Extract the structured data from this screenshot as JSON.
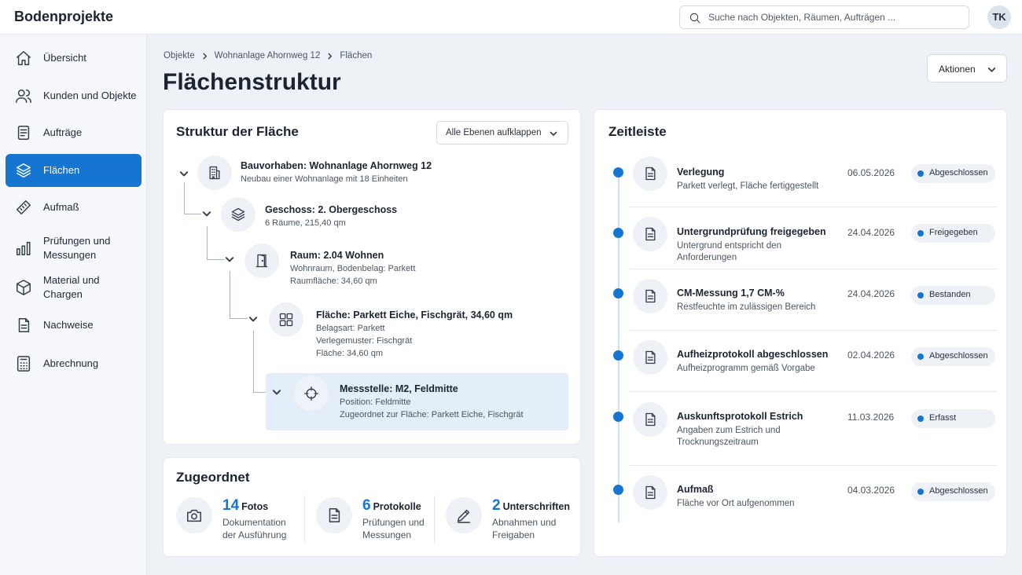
{
  "header": {
    "app_title": "Bodenprojekte",
    "search_placeholder": "Suche nach Objekten, Räumen, Aufträgen ...",
    "user_initials": "TK"
  },
  "sidebar": {
    "items": [
      {
        "label": "Übersicht",
        "icon": "home-icon",
        "active": false
      },
      {
        "label": "Kunden und Objekte",
        "icon": "users-icon",
        "active": false
      },
      {
        "label": "Aufträge",
        "icon": "document-icon",
        "active": false
      },
      {
        "label": "Flächen",
        "icon": "layers-icon",
        "active": true
      },
      {
        "label": "Aufmaß",
        "icon": "ruler-icon",
        "active": false
      },
      {
        "label": "Prüfungen und Messungen",
        "icon": "bar-chart-icon",
        "active": false
      },
      {
        "label": "Material und Chargen",
        "icon": "box-icon",
        "active": false
      },
      {
        "label": "Nachweise",
        "icon": "file-check-icon",
        "active": false
      },
      {
        "label": "Abrechnung",
        "icon": "calculator-icon",
        "active": false
      }
    ]
  },
  "breadcrumb": [
    "Objekte",
    "Wohnanlage Ahornweg 12",
    "Flächen"
  ],
  "page_title": "Flächenstruktur",
  "actions_label": "Aktionen",
  "structure": {
    "title": "Struktur der Fläche",
    "expand_label": "Alle Ebenen aufklappen",
    "nodes": [
      {
        "title": "Bauvorhaben: Wohnanlage Ahornweg 12",
        "lines": [
          "Neubau einer Wohnanlage mit 18 Einheiten"
        ],
        "icon": "building-icon"
      },
      {
        "title": "Geschoss: 2. Obergeschoss",
        "lines": [
          "6 Räume, 215,40 qm"
        ],
        "icon": "layers-icon"
      },
      {
        "title": "Raum: 2.04 Wohnen",
        "lines": [
          "Wohnraum, Bodenbelag: Parkett",
          "Raumfläche: 34,60 qm"
        ],
        "icon": "door-icon"
      },
      {
        "title": "Fläche: Parkett Eiche, Fischgrät, 34,60 qm",
        "lines": [
          "Belagsart: Parkett",
          "Verlegemuster: Fischgrät",
          "Fläche: 34,60 qm"
        ],
        "icon": "grid-icon"
      },
      {
        "title": "Messstelle: M2, Feldmitte",
        "lines": [
          "Position: Feldmitte",
          "Zugeordnet zur Fläche: Parkett Eiche, Fischgrät"
        ],
        "icon": "crosshair-icon",
        "selected": true
      }
    ]
  },
  "assigned": {
    "title": "Zugeordnet",
    "stats": [
      {
        "number": "14",
        "label": "Fotos",
        "desc": "Dokumentation der Ausführung",
        "icon": "camera-icon"
      },
      {
        "number": "6",
        "label": "Protokolle",
        "desc": "Prüfungen und Messungen",
        "icon": "document-icon"
      },
      {
        "number": "2",
        "label": "Unterschriften",
        "desc": "Abnahmen und Freigaben",
        "icon": "pen-icon"
      }
    ]
  },
  "timeline": {
    "title": "Zeitleiste",
    "items": [
      {
        "title": "Verlegung",
        "desc": "Parkett verlegt, Fläche fertiggestellt",
        "date": "06.05.2026",
        "status": "Abgeschlossen"
      },
      {
        "title": "Untergrundprüfung freigegeben",
        "desc": "Untergrund entspricht den Anforderungen",
        "date": "24.04.2026",
        "status": "Freigegeben"
      },
      {
        "title": "CM-Messung 1,7 CM-%",
        "desc": "Restfeuchte im zulässigen Bereich",
        "date": "24.04.2026",
        "status": "Bestanden"
      },
      {
        "title": "Aufheizprotokoll abgeschlossen",
        "desc": "Aufheizprogramm gemäß Vorgabe",
        "date": "02.04.2026",
        "status": "Abgeschlossen"
      },
      {
        "title": "Auskunftsprotokoll Estrich",
        "desc": "Angaben zum Estrich und Trocknungszeitraum",
        "date": "11.03.2026",
        "status": "Erfasst"
      },
      {
        "title": "Aufmaß",
        "desc": "Fläche vor Ort aufgenommen",
        "date": "04.03.2026",
        "status": "Abgeschlossen"
      }
    ]
  },
  "colors": {
    "accent": "#1675d1",
    "selected_bg": "#e3eef9",
    "page_bg": "#eef2f6"
  }
}
